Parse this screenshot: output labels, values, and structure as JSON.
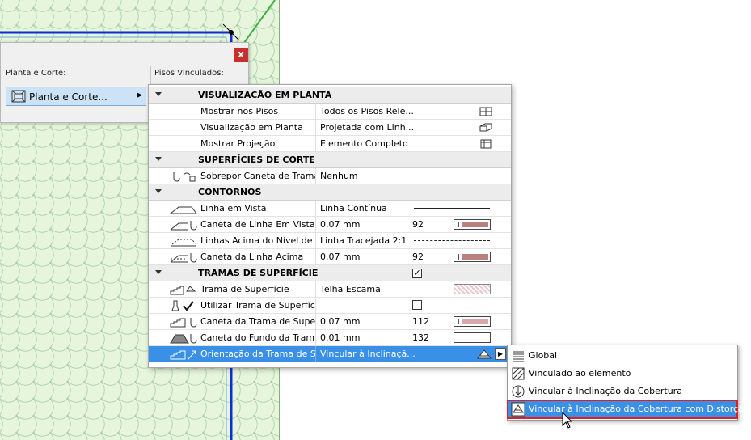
{
  "dialog": {
    "close_label": "x",
    "left_label": "Planta e Corte:",
    "right_label": "Pisos Vinculados:",
    "button_label": "Planta e Corte..."
  },
  "panel": {
    "sections": [
      {
        "title": "VISUALIZAÇÃO EM PLANTA"
      },
      {
        "title": "SUPERFÍCIES DE CORTE"
      },
      {
        "title": "CONTORNOS"
      },
      {
        "title": "TRAMAS DE SUPERFÍCIE"
      }
    ],
    "rows": {
      "mostrar_pisos": {
        "name": "Mostrar nos Pisos",
        "value": "Todos os Pisos Rele..."
      },
      "visualizacao_planta": {
        "name": "Visualização em Planta",
        "value": "Projetada com Linh..."
      },
      "mostrar_projecao": {
        "name": "Mostrar Projeção",
        "value": "Elemento Completo"
      },
      "sobrepor_caneta": {
        "name": "Sobrepor Caneta de Trama...",
        "value": "Nenhum"
      },
      "linha_vista": {
        "name": "Linha em Vista",
        "value": "Linha Contínua"
      },
      "caneta_linha_vista": {
        "name": "Caneta de Linha Em Vista",
        "value": "0.07 mm",
        "num": "92"
      },
      "linhas_acima": {
        "name": "Linhas Acima do Nível de ...",
        "value": "Linha Tracejada 2:1"
      },
      "caneta_linha_acima": {
        "name": "Caneta da Linha Acima",
        "value": "0.07 mm",
        "num": "92"
      },
      "trama_superficie": {
        "name": "Trama de Superfície",
        "value": "Telha Escama"
      },
      "utilizar_trama": {
        "name": "Utilizar Trama de Superfície"
      },
      "caneta_trama": {
        "name": "Caneta da Trama de Super...",
        "value": "0.07 mm",
        "num": "112"
      },
      "caneta_fundo": {
        "name": "Caneta do Fundo da Tram...",
        "value": "0.01 mm",
        "num": "132"
      },
      "orientacao_trama": {
        "name": "Orientação da Trama de S...",
        "value": "Vincular à Inclinaçã..."
      }
    },
    "tramas_section_checked": true,
    "utilizar_trama_checked": false
  },
  "menu": {
    "items": [
      {
        "label": "Global"
      },
      {
        "label": "Vinculado ao elemento"
      },
      {
        "label": "Vincular à Inclinação da Cobertura"
      },
      {
        "label": "Vincular à Inclinação da Cobertura com Distorção"
      }
    ],
    "selected_index": 3
  },
  "colors": {
    "selection": "#3a8fe6",
    "highlight_border": "#e02020",
    "pen_swatch": "#b98080",
    "plan_fill": "#e6f5dc",
    "plan_line_blue": "#0a2fd6",
    "plan_line_green": "#3cb043"
  }
}
